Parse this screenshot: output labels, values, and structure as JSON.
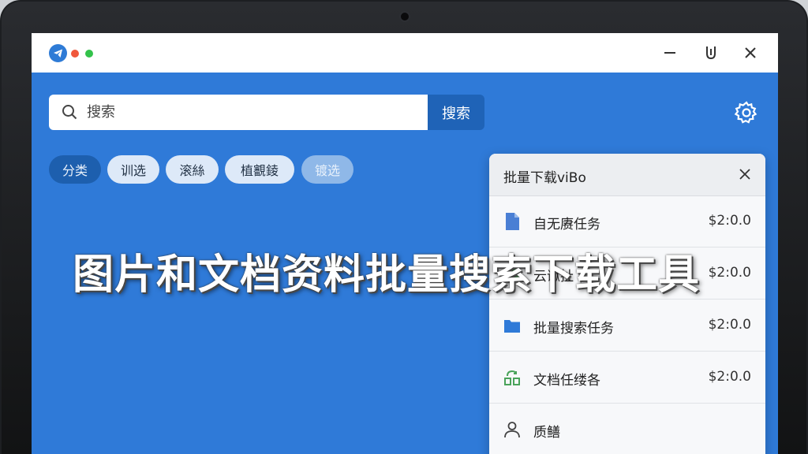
{
  "window": {
    "controls": [
      "minimize-icon",
      "pin-icon",
      "close-icon"
    ]
  },
  "search": {
    "placeholder": "搜索",
    "button_label": "搜索"
  },
  "chips": [
    {
      "label": "分类",
      "state": "active"
    },
    {
      "label": "训选",
      "state": "normal"
    },
    {
      "label": "滚絲",
      "state": "normal"
    },
    {
      "label": "植覾錂",
      "state": "normal"
    },
    {
      "label": "镀选",
      "state": "faded"
    }
  ],
  "headline": "图片和文档资料批量搜索下载工具",
  "panel": {
    "title": "批量下载viBo",
    "tasks": [
      {
        "name": "自无赓任务",
        "price": "$2:0.0",
        "icon": "document-icon"
      },
      {
        "name": "云谳扯",
        "price": "$2:0.0",
        "icon": "cloud-icon"
      },
      {
        "name": "批量搜索任务",
        "price": "$2:0.0",
        "icon": "folder-icon"
      },
      {
        "name": "文档任缕各",
        "price": "$2:0.0",
        "icon": "sync-icon"
      },
      {
        "name": "质鳝",
        "price": "",
        "icon": "user-icon"
      }
    ]
  },
  "colors": {
    "screen_bg": "#2f7ad8",
    "accent": "#1f63b7",
    "panel_bg": "#f7f8fa"
  }
}
